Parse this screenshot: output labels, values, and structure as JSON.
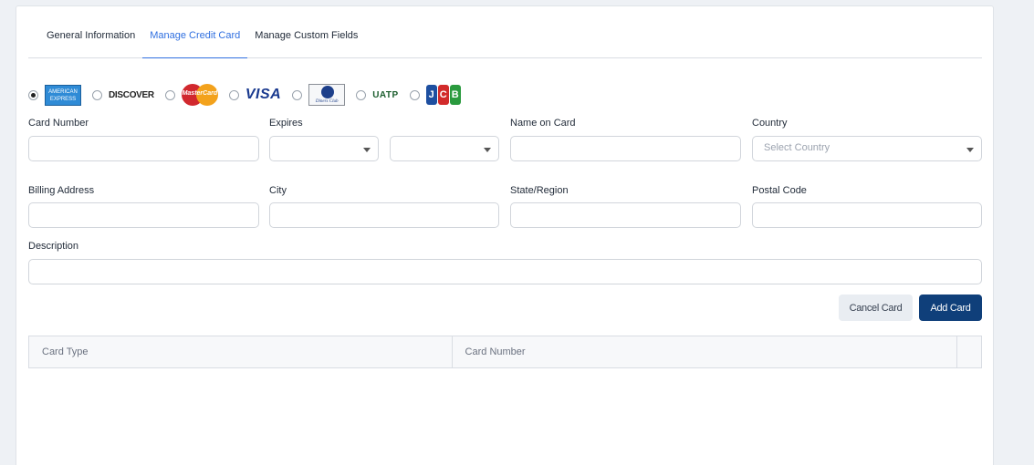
{
  "tabs": [
    {
      "label": "General Information"
    },
    {
      "label": "Manage Credit Card"
    },
    {
      "label": "Manage Custom Fields"
    }
  ],
  "active_tab": "Manage Credit Card",
  "card_types": [
    {
      "name": "American Express",
      "logo_text": "AMERICAN EXPRESS",
      "selected": true
    },
    {
      "name": "Discover",
      "logo_text": "DISCOVER",
      "selected": false
    },
    {
      "name": "MasterCard",
      "logo_text": "MasterCard",
      "selected": false
    },
    {
      "name": "Visa",
      "logo_text": "VISA",
      "selected": false
    },
    {
      "name": "Diners Club",
      "logo_text": "Diners Club",
      "selected": false
    },
    {
      "name": "UATP",
      "logo_text": "UATP",
      "selected": false
    },
    {
      "name": "JCB",
      "logo_text": "JCB",
      "selected": false
    }
  ],
  "form": {
    "card_number_label": "Card Number",
    "expires_label": "Expires",
    "name_on_card_label": "Name on Card",
    "country_label": "Country",
    "country_placeholder": "Select Country",
    "billing_address_label": "Billing Address",
    "city_label": "City",
    "state_label": "State/Region",
    "postal_code_label": "Postal Code",
    "description_label": "Description",
    "card_number_value": "",
    "name_on_card_value": "",
    "billing_address_value": "",
    "city_value": "",
    "state_value": "",
    "postal_code_value": "",
    "description_value": "",
    "expires_month_value": "",
    "expires_year_value": ""
  },
  "buttons": {
    "cancel": "Cancel Card",
    "add": "Add Card"
  },
  "table": {
    "columns": [
      "Card Type",
      "Card Number",
      ""
    ]
  },
  "colors": {
    "accent": "#2f6fe0",
    "primary_button": "#0f3f7a",
    "secondary_button": "#e9edf2",
    "page_bg": "#eef1f5"
  }
}
